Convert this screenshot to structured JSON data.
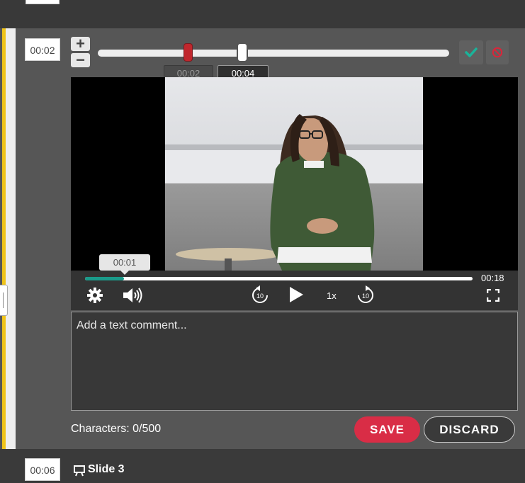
{
  "top_entry": {
    "timestamp": ""
  },
  "comment_entry": {
    "timestamp": "00:02",
    "zoom_in_label": "+",
    "zoom_out_label": "−",
    "range": {
      "start_label": "00:02",
      "end_label": "00:04"
    },
    "actions": {
      "confirm_icon": "check-icon",
      "cancel_icon": "no-entry-icon"
    },
    "player": {
      "hover_time": "00:01",
      "total_time": "00:18",
      "progress_fraction": 0.1,
      "speed": "1x",
      "rewind_seconds": "10",
      "forward_seconds": "10"
    },
    "comment": {
      "placeholder": "Add a text comment...",
      "value": ""
    },
    "characters_label": "Characters:",
    "characters_count": "0/500",
    "save_label": "SAVE",
    "discard_label": "DISCARD"
  },
  "next_entry": {
    "timestamp": "00:06",
    "title": "Slide 3",
    "icon": "presentation-icon"
  },
  "colors": {
    "accent": "#f0c419",
    "save": "#d92d46",
    "progress": "#1a9a8a",
    "range_start": "#c0272d",
    "confirm": "#1ab39a",
    "cancel": "#d9263a"
  }
}
